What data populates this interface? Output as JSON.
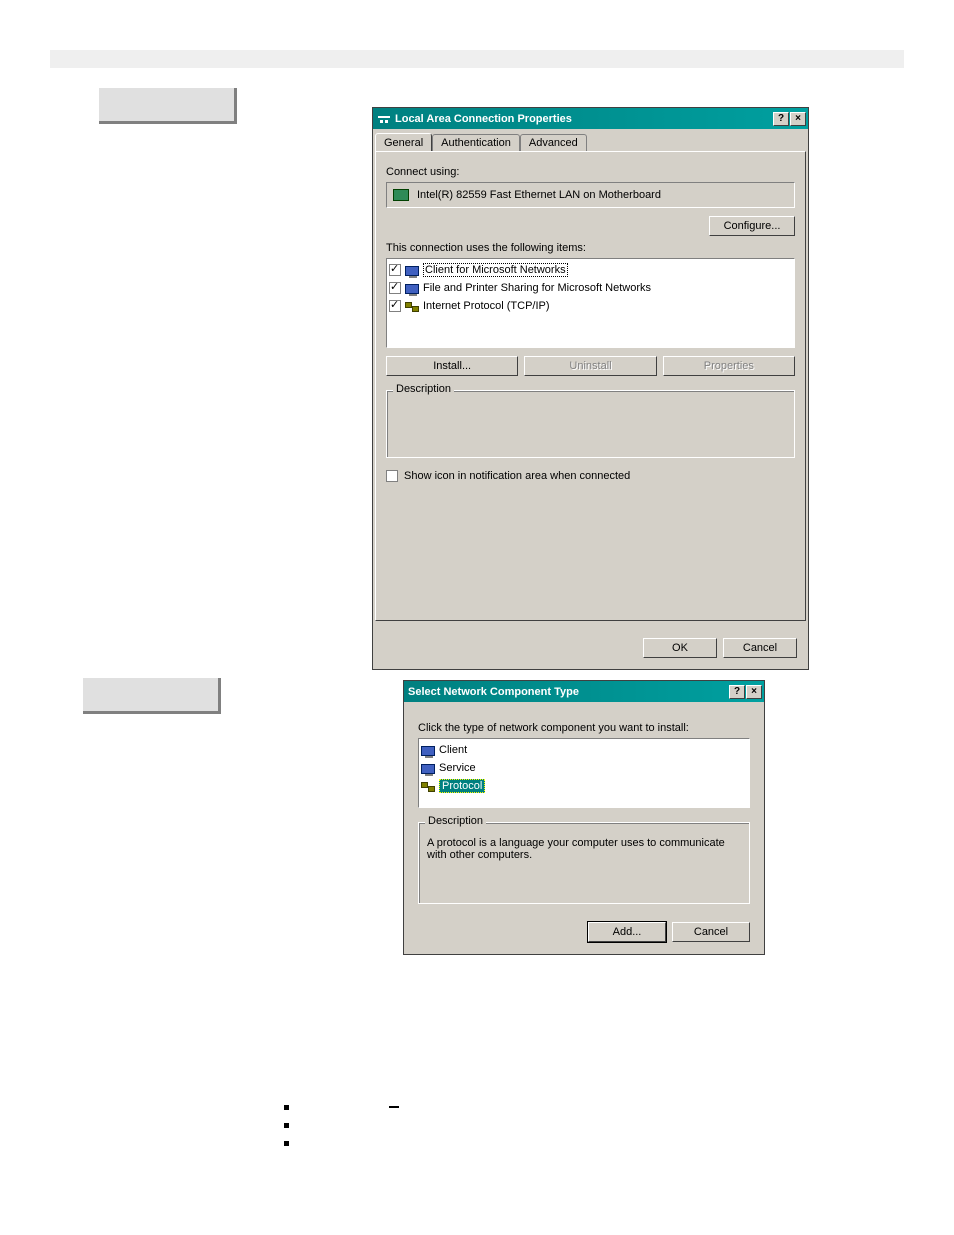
{
  "dialog1": {
    "title": "Local Area Connection Properties",
    "tabs": [
      "General",
      "Authentication",
      "Advanced"
    ],
    "connect_using_label": "Connect using:",
    "adapter_name": "Intel(R) 82559 Fast Ethernet LAN on Motherboard",
    "configure_btn": "Configure...",
    "items_label": "This connection uses the following items:",
    "items": [
      {
        "checked": true,
        "icon": "monitor",
        "label": "Client for Microsoft Networks",
        "selected": true
      },
      {
        "checked": true,
        "icon": "monitor",
        "label": "File and Printer Sharing for Microsoft Networks",
        "selected": false
      },
      {
        "checked": true,
        "icon": "protocol",
        "label": "Internet Protocol (TCP/IP)",
        "selected": false
      }
    ],
    "install_btn": "Install...",
    "uninstall_btn": "Uninstall",
    "properties_btn": "Properties",
    "description_legend": "Description",
    "show_icon_label": "Show icon in notification area when connected",
    "ok_btn": "OK",
    "cancel_btn": "Cancel"
  },
  "dialog2": {
    "title": "Select Network Component Type",
    "instruction": "Click the type of network component you want to install:",
    "options": [
      {
        "icon": "monitor",
        "label": "Client",
        "selected": false
      },
      {
        "icon": "monitor",
        "label": "Service",
        "selected": false
      },
      {
        "icon": "protocol",
        "label": "Protocol",
        "selected": true
      }
    ],
    "description_legend": "Description",
    "description_text": "A protocol is a language your computer uses to communicate with other computers.",
    "add_btn": "Add...",
    "cancel_btn": "Cancel"
  }
}
